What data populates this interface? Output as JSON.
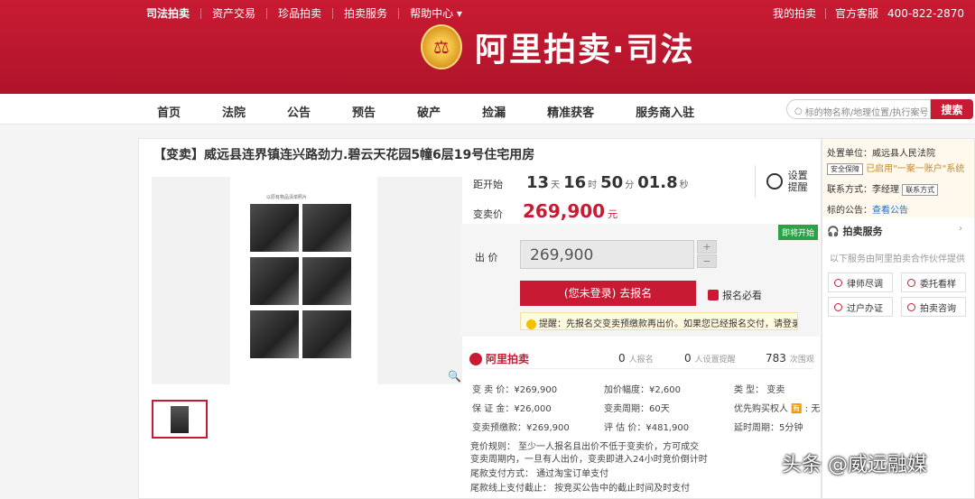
{
  "header": {
    "top_links": [
      "司法拍卖",
      "资产交易",
      "珍品拍卖",
      "拍卖服务",
      "帮助中心 ▾"
    ],
    "my_auction": "我的拍卖",
    "customer_service": "官方客服",
    "phone": "400-822-2870",
    "logo_text": "阿里拍卖·司法"
  },
  "nav": {
    "items": [
      "首页",
      "法院",
      "公告",
      "预告",
      "破产",
      "捡漏",
      "精准获客",
      "服务商入驻"
    ],
    "search_placeholder": "标的物名称/地理位置/执行案号",
    "search_button": "搜索"
  },
  "item": {
    "title": "【变卖】威远县连界镇连兴路劲力.碧云天花园5幢6层19号住宅用房",
    "doc_caption": "以原有物品清单照片"
  },
  "countdown": {
    "label": "距开始",
    "days": "13",
    "days_unit": "天",
    "hours": "16",
    "hours_unit": "时",
    "minutes": "50",
    "minutes_unit": "分",
    "seconds": "01.8",
    "seconds_unit": "秒",
    "remind_label": "设置提醒"
  },
  "price": {
    "label": "变卖价",
    "value": "269,900",
    "unit": "元"
  },
  "bid": {
    "badge": "即将开始",
    "label": "出  价",
    "value": "269,900",
    "plus": "+",
    "minus": "−",
    "signup_button": "(您未登录) 去报名",
    "must_see": "报名必看",
    "tip": "提醒：先报名交变卖预缴款再出价。如果您已经报名交付，请登录"
  },
  "stats": {
    "brand": "阿里拍卖",
    "signups": "0",
    "signups_label": "人报名",
    "reminders": "0",
    "reminders_label": "人设置提醒",
    "views": "783",
    "views_label": "次围观"
  },
  "details": {
    "c1": [
      "变 卖 价：¥269,900",
      "保 证 金：¥26,000",
      "变卖预缴款：¥269,900"
    ],
    "c2": [
      "加价幅度：¥2,600",
      "变卖周期：60天",
      "评 估 价：¥481,900"
    ],
    "c3": [
      "类    型：  变卖",
      "优先购买权人 🈶 : 无",
      "延时周期：5分钟"
    ],
    "rules": [
      "竞价规则：   至少一人报名且出价不低于变卖价，方可成交",
      "                    变卖周期内，一旦有人出价，变卖即进入24小时竞价倒计时",
      "尾款支付方式：   通过淘宝订单支付",
      "尾款线上支付截止：   按竞买公告中的截止时间及时支付"
    ]
  },
  "sidebar": {
    "unit_label": "处置单位：",
    "unit": "威远县人民法院",
    "secure_tag": "安全保障",
    "account_text": "已启用\"一案一账户\"系统",
    "contact_label": "联系方式：",
    "contact": "李经理",
    "contact_tag": "联系方式",
    "notice_label": "标的公告：",
    "notice_link": "查看公告",
    "service_title": "拍卖服务",
    "service_desc": "以下服务由阿里拍卖合作伙伴提供",
    "services": [
      "律师尽调",
      "委托看样",
      "过户办证",
      "拍卖咨询"
    ]
  },
  "watermark": "头条 @威远融媒",
  "colors": {
    "brand": "#c81b33",
    "badge": "#2da147"
  }
}
